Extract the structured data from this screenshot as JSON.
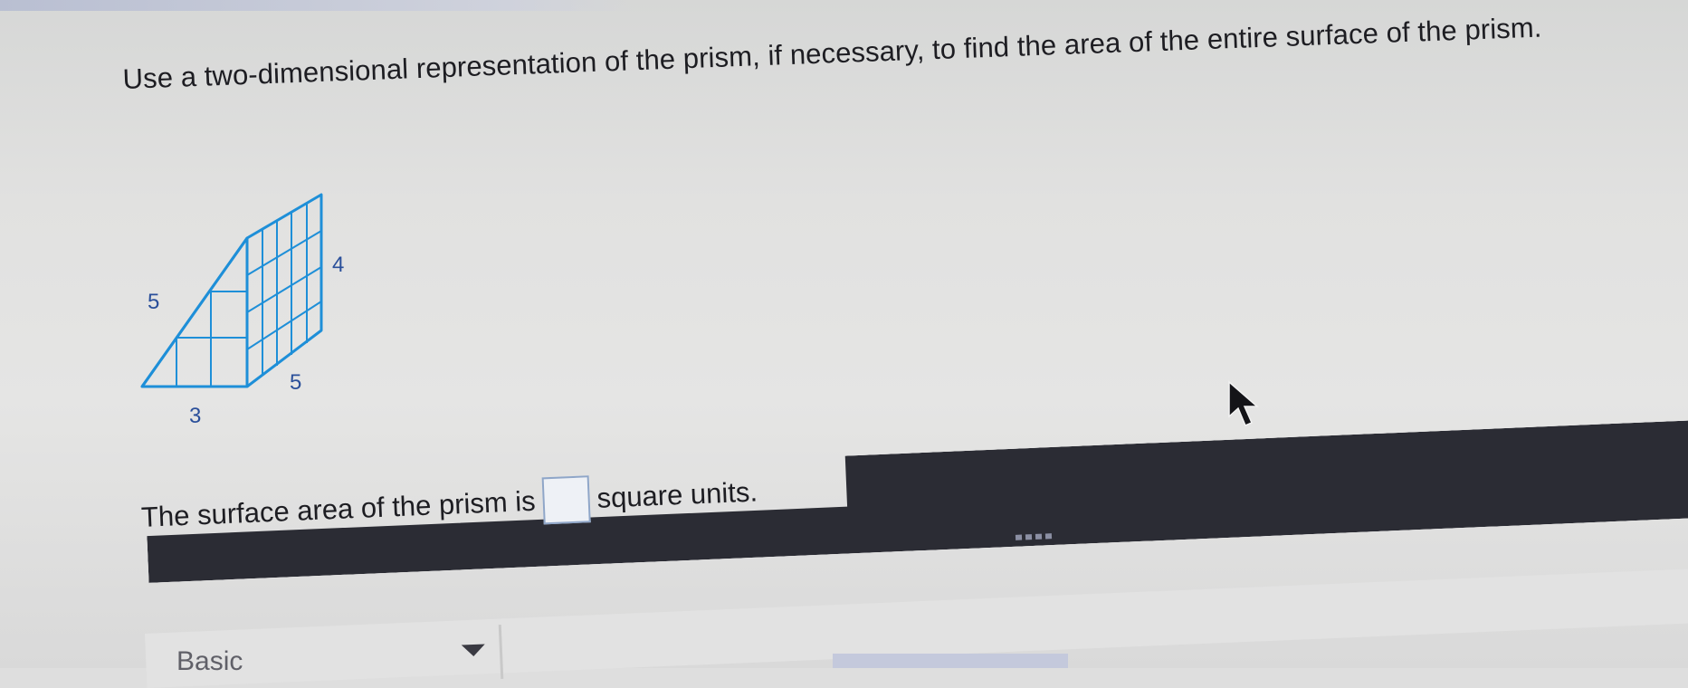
{
  "question": {
    "prompt": "Use a two-dimensional representation of the prism, if necessary, to find the area of the entire surface of the prism."
  },
  "figure": {
    "label_hypotenuse": "5",
    "label_height": "4",
    "label_depth": "5",
    "label_base": "3",
    "stroke_color": "#1e8fd8"
  },
  "answer": {
    "prefix": "The surface area of the prism is",
    "suffix": "square units.",
    "value": ""
  },
  "toolbar": {
    "more_label": "····"
  },
  "mode": {
    "selected": "Basic"
  }
}
